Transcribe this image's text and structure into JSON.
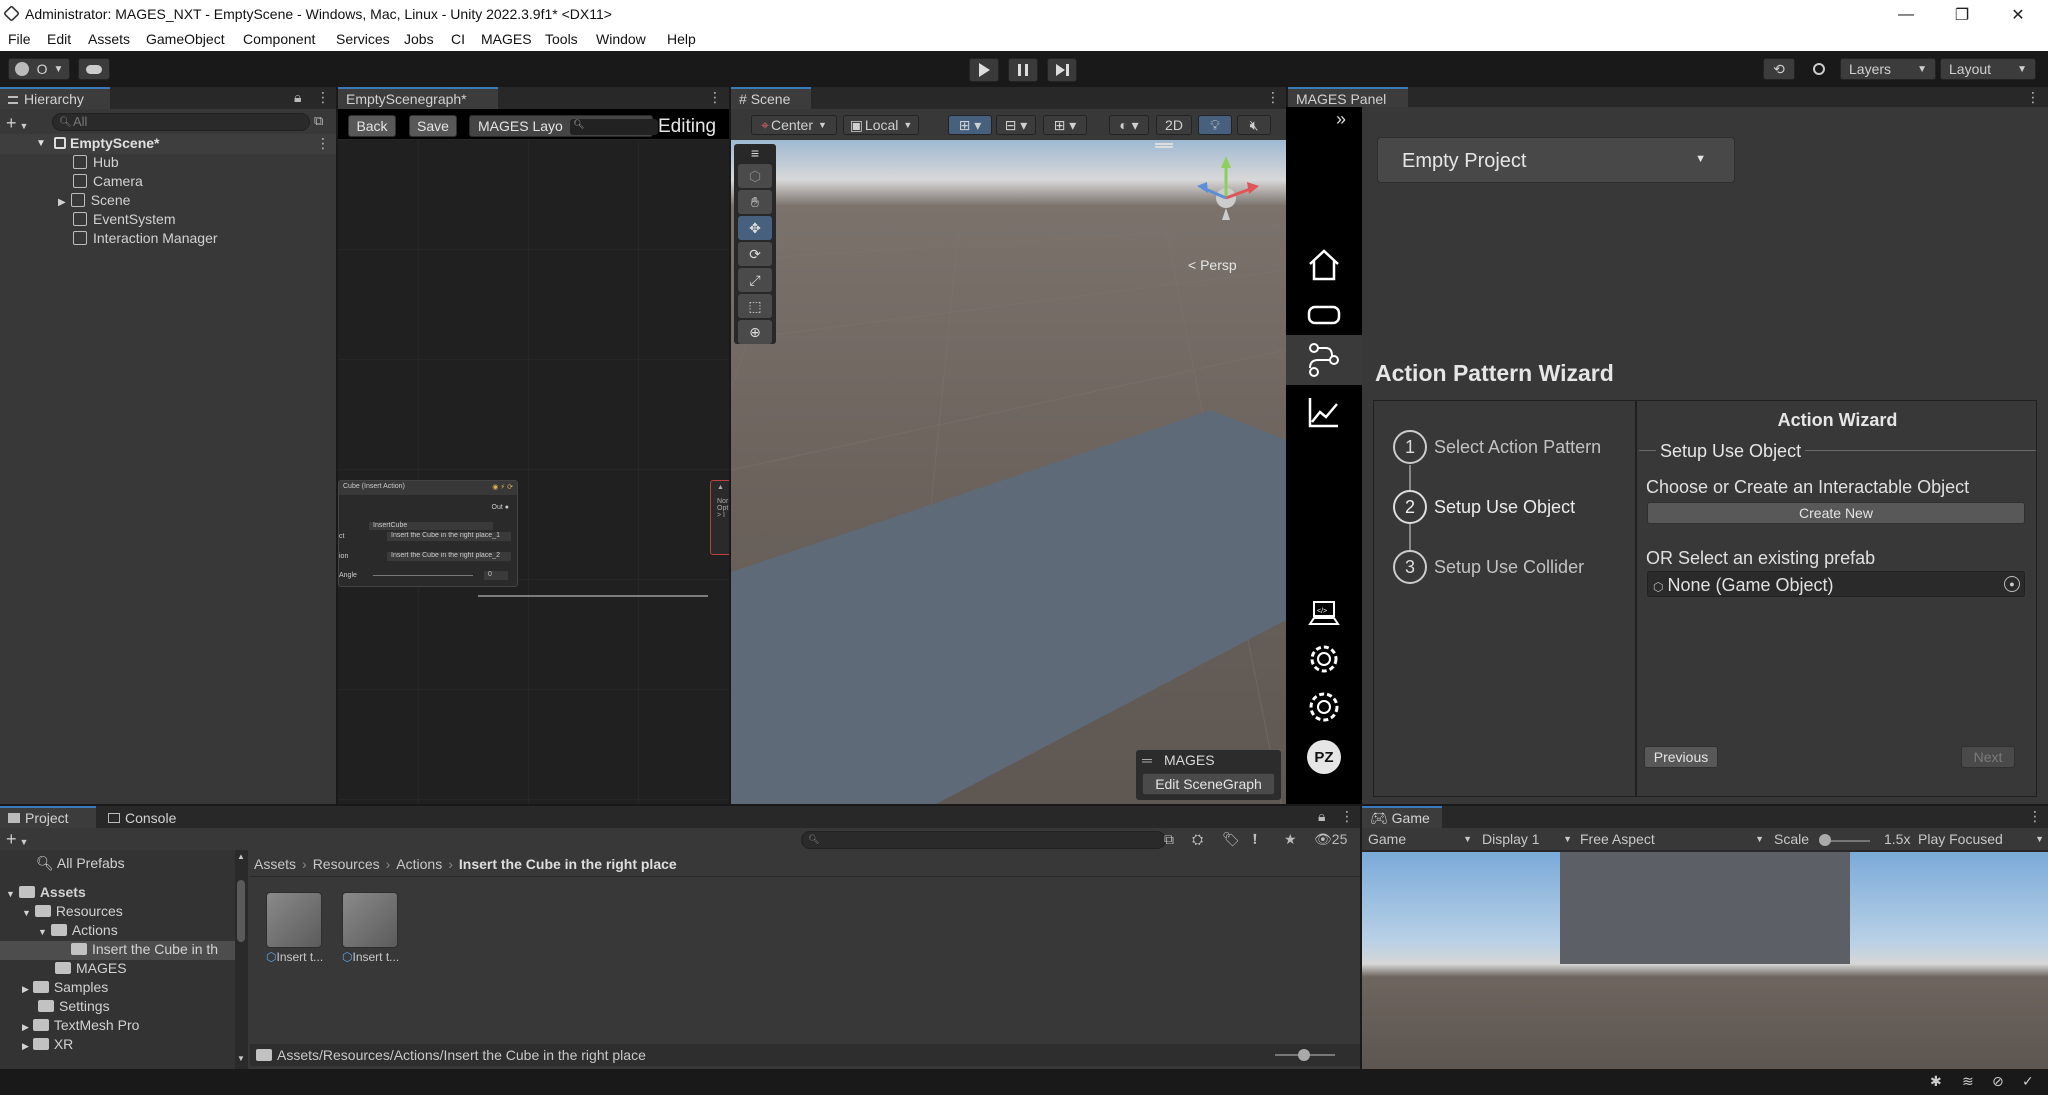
{
  "window": {
    "title": "Administrator: MAGES_NXT - EmptyScene - Windows, Mac, Linux - Unity 2022.3.9f1* <DX11>",
    "minimize": "—",
    "maximize": "❐",
    "close": "✕"
  },
  "menu": [
    "File",
    "Edit",
    "Assets",
    "GameObject",
    "Component",
    "Services",
    "Jobs",
    "CI",
    "MAGES",
    "Tools",
    "Window",
    "Help"
  ],
  "toolbar": {
    "account_count": "O",
    "layers": "Layers",
    "layout": "Layout"
  },
  "hierarchy": {
    "tab": "Hierarchy",
    "search_placeholder": "All",
    "scene": "EmptyScene*",
    "items": [
      "Hub",
      "Camera",
      "Scene",
      "EventSystem",
      "Interaction Manager"
    ]
  },
  "scenegraph": {
    "tab": "EmptyScenegraph*",
    "back": "Back",
    "save": "Save",
    "layout_field": "MAGES Layo",
    "mode": "Editing",
    "node": {
      "title": "Cube (Insert Action)",
      "out": "Out",
      "field_name": "InsertCube",
      "row1_label": "ct",
      "row1_value": "Insert the Cube in the right place_1",
      "row2_label": "ion",
      "row2_value": "Insert the Cube in the right place_2",
      "row3_label": "Angle",
      "row3_value": "0"
    }
  },
  "scene": {
    "tab": "Scene",
    "pivot": "Center",
    "space": "Local",
    "mode_2d": "2D",
    "persp": "Persp",
    "overlay_title": "MAGES",
    "overlay_button": "Edit SceneGraph"
  },
  "mages_panel": {
    "tab": "MAGES Panel",
    "project_dropdown": "Empty Project",
    "wizard_title": "Action Pattern Wizard",
    "steps": [
      {
        "num": "1",
        "label": "Select Action Pattern"
      },
      {
        "num": "2",
        "label": "Setup Use Object"
      },
      {
        "num": "3",
        "label": "Setup Use Collider"
      }
    ],
    "right_title": "Action Wizard",
    "section_title": "Setup Use Object",
    "choose_label": "Choose or Create an Interactable Object",
    "create_button": "Create New",
    "or_label": "OR Select an existing prefab",
    "prefab_field": "None (Game Object)",
    "previous": "Previous",
    "next": "Next",
    "avatar": "PZ"
  },
  "project": {
    "tab_project": "Project",
    "tab_console": "Console",
    "hidden_count": "25",
    "all_prefabs": "All Prefabs",
    "tree": {
      "assets": "Assets",
      "resources": "Resources",
      "actions": "Actions",
      "insert": "Insert the Cube in th",
      "mages": "MAGES",
      "samples": "Samples",
      "settings": "Settings",
      "textmesh": "TextMesh Pro",
      "xr": "XR"
    },
    "breadcrumb": [
      "Assets",
      "Resources",
      "Actions",
      "Insert the Cube in the right place"
    ],
    "files": [
      "Insert t...",
      "Insert t..."
    ],
    "path": "Assets/Resources/Actions/Insert the Cube in the right place"
  },
  "game": {
    "tab": "Game",
    "view": "Game",
    "display": "Display 1",
    "aspect": "Free Aspect",
    "scale_label": "Scale",
    "scale_value": "1.5x",
    "play_mode": "Play Focused",
    "scale_fraction": 0.1
  }
}
